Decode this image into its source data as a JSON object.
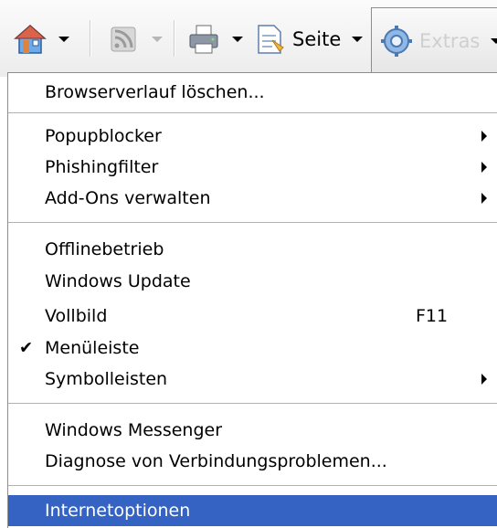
{
  "toolbar": {
    "page_label": "Seite",
    "extras_label": "Extras",
    "icons": [
      "home-icon",
      "feeds-icon",
      "print-icon",
      "page-icon",
      "tools-icon"
    ]
  },
  "menu": {
    "browserverlauf": "Browserverlauf löschen...",
    "popupblocker": "Popupblocker",
    "phishingfilter": "Phishingfilter",
    "addons": "Add-Ons verwalten",
    "offlinebetrieb": "Offlinebetrieb",
    "windows_update": "Windows Update",
    "vollbild": "Vollbild",
    "vollbild_shortcut": "F11",
    "menueleiste": "Menüleiste",
    "menueleiste_checked": true,
    "symbolleisten": "Symbolleisten",
    "messenger": "Windows Messenger",
    "diagnose": "Diagnose von Verbindungsproblemen...",
    "internetoptionen": "Internetoptionen"
  },
  "colors": {
    "highlight": "#3563c4",
    "separator": "#b1b1b1",
    "disabled_text": "#cfcfcf"
  }
}
